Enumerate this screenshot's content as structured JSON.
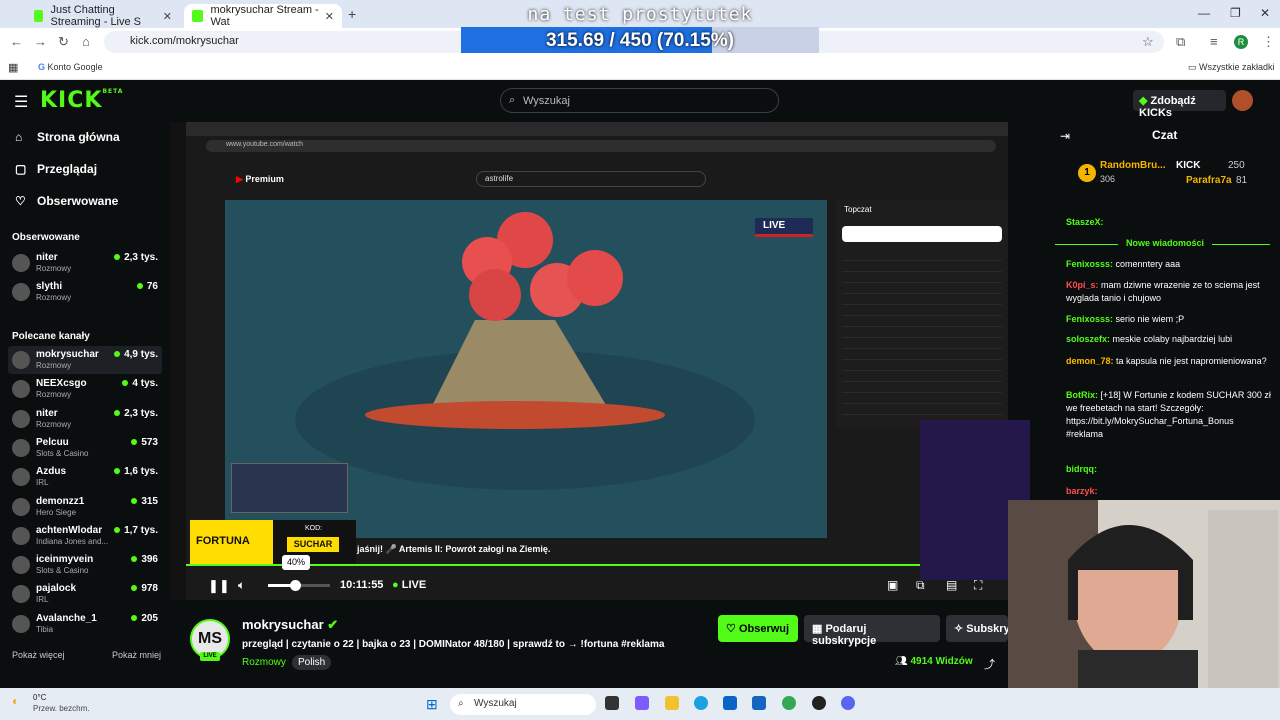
{
  "browser": {
    "tabs": [
      {
        "title": "Just Chatting Streaming - Live S"
      },
      {
        "title": "mokrysuchar Stream - Wat"
      }
    ],
    "url": "kick.com/mokrysuchar",
    "profile_initial": "R",
    "bookmarks": {
      "left": "Konto Google",
      "right": "Wszystkie zakładki"
    }
  },
  "overlay": {
    "goal_title": "na test prostytutek",
    "progress_text": "315.69 / 450 (70.15%)",
    "progress_fraction": 0.7015
  },
  "kick": {
    "logo": "KICK",
    "logo_badge": "BETA",
    "search_placeholder": "Wyszukaj",
    "get_kicks": "Zdobądź KICKs"
  },
  "sidebar": {
    "main_nav": [
      "Strona główna",
      "Przeglądaj",
      "Obserwowane"
    ],
    "followed_title": "Obserwowane",
    "followed": [
      {
        "name": "niter",
        "category": "Rozmowy",
        "viewers": "2,3 tys."
      },
      {
        "name": "slythi",
        "category": "Rozmowy",
        "viewers": "76"
      }
    ],
    "recommended_title": "Polecane kanały",
    "recommended": [
      {
        "name": "mokrysuchar",
        "category": "Rozmowy",
        "viewers": "4,9 tys."
      },
      {
        "name": "NEEXcsgo",
        "category": "Rozmowy",
        "viewers": "4 tys."
      },
      {
        "name": "niter",
        "category": "Rozmowy",
        "viewers": "2,3 tys."
      },
      {
        "name": "Pelcuu",
        "category": "Slots & Casino",
        "viewers": "573"
      },
      {
        "name": "Azdus",
        "category": "IRL",
        "viewers": "1,6 tys."
      },
      {
        "name": "demonzz1",
        "category": "Hero Siege",
        "viewers": "315"
      },
      {
        "name": "achtenWlodar",
        "category": "Indiana Jones and...",
        "viewers": "1,7 tys."
      },
      {
        "name": "iceinmyvein",
        "category": "Slots & Casino",
        "viewers": "396"
      },
      {
        "name": "pajalock",
        "category": "IRL",
        "viewers": "978"
      },
      {
        "name": "Avalanche_1",
        "category": "Tibia",
        "viewers": "205"
      }
    ],
    "show_more": "Pokaż więcej",
    "show_less": "Pokaż mniej"
  },
  "player": {
    "volume_tooltip": "40%",
    "volume_level": 0.4,
    "time": "10:11:55",
    "live_label": "LIVE",
    "ad_brand": "FORTUNA",
    "ad_code_label": "KOD:",
    "ad_code": "SUCHAR",
    "inner_caption": "jaśnij! 🎤 Artemis II: Powrót załogi na Ziemię.",
    "inner_yt_url": "www.youtube.com/watch",
    "inner_yt_search": "astrolife",
    "inner_yt_chat_title": "Topczat",
    "inner_live_badge": "LIVE"
  },
  "stream": {
    "avatar_initials": "MS",
    "live_badge": "LIVE",
    "streamer": "mokrysuchar",
    "title": "przegląd | czytanie o 22 | bajka o 23 | DOMINator 48/180 | sprawdź to → !fortuna  #reklama",
    "category": "Rozmowy",
    "language": "Polish",
    "follow_label": "Obserwuj",
    "gift_label": "Podaruj subskrypcje",
    "subscribe_label": "Subskry",
    "viewers": "4914 Widzów"
  },
  "chat": {
    "title": "Czat",
    "leaderboard": [
      {
        "name": "RandomBru...",
        "value": "306"
      },
      {
        "name": "KICK",
        "value": "250"
      },
      {
        "name": "Parafra7a",
        "value": "81"
      }
    ],
    "new_messages_label": "Nowe wiadomości",
    "messages": [
      {
        "user": "StaszeX:",
        "color": "#53fc18",
        "text": ""
      },
      {
        "user": "Fenixosss:",
        "color": "#53fc18",
        "text": "comenntery aaa"
      },
      {
        "user": "K0pi_s:",
        "color": "#ff4d4d",
        "text": "mam dziwne wrazenie ze to sciema jest wyglada tanio i chujowo"
      },
      {
        "user": "Fenixosss:",
        "color": "#53fc18",
        "text": "serio nie wiem ;P"
      },
      {
        "user": "soloszefx:",
        "color": "#53fc18",
        "text": "meskie colaby najbardziej lubi"
      },
      {
        "user": "demon_78:",
        "color": "#ffb800",
        "text": "ta kapsula nie jest napromieniowana?"
      },
      {
        "user": "BotRix:",
        "color": "#53fc18",
        "text": "[+18] W Fortunie z kodem SUCHAR 300 zł we freebetach na start! Szczegóły: https://bit.ly/MokrySuchar_Fortuna_Bonus #reklama"
      },
      {
        "user": "bidrqq:",
        "color": "#53fc18",
        "text": ""
      },
      {
        "user": "barzyk:",
        "color": "#ff4d4d",
        "text": ""
      }
    ]
  },
  "taskbar": {
    "weather_temp": "0°C",
    "weather_desc": "Przew. bezchm.",
    "search_placeholder": "Wyszukaj"
  }
}
